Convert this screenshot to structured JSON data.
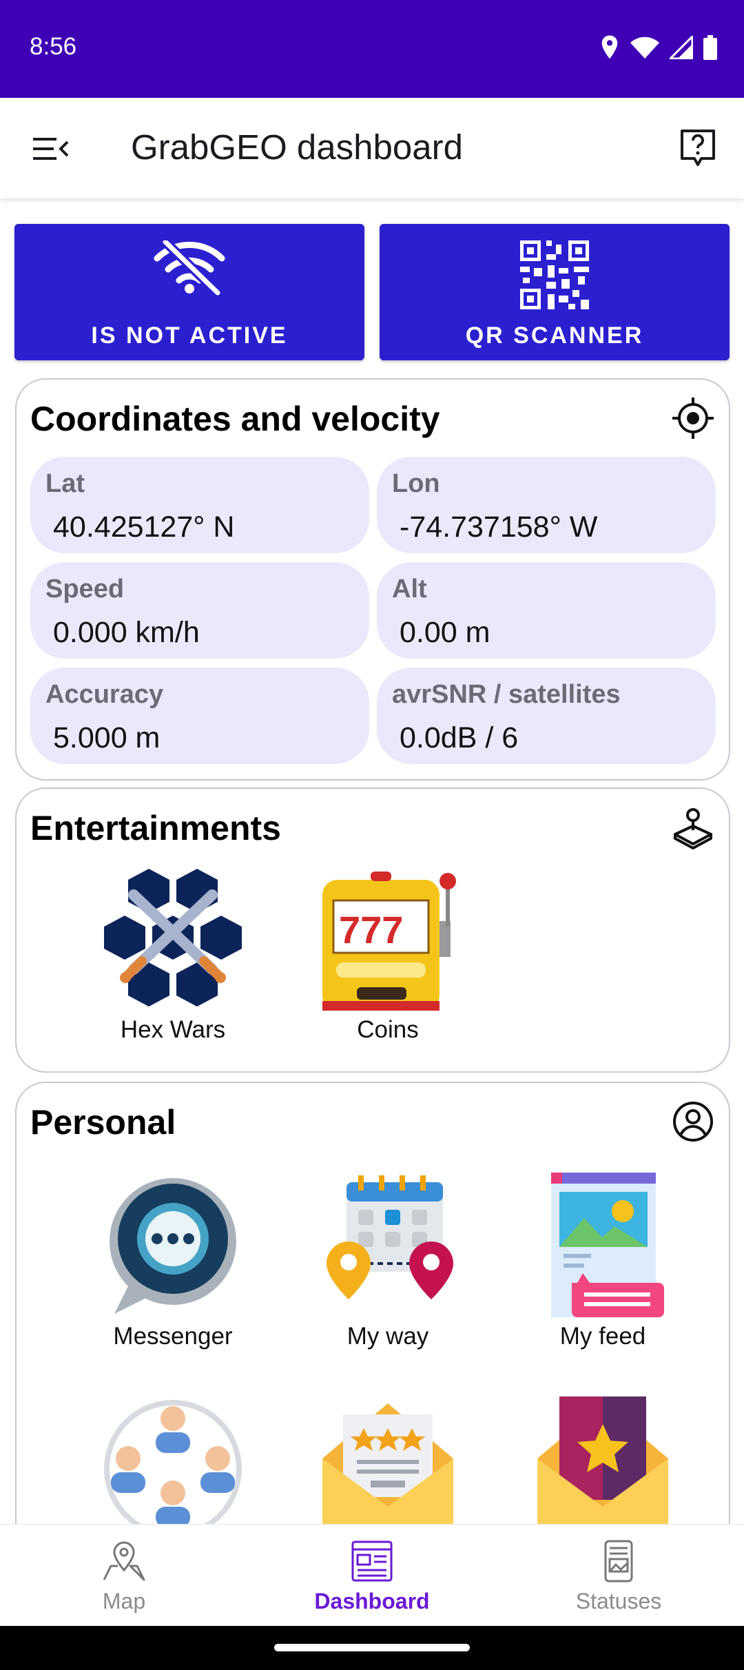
{
  "status": {
    "time": "8:56"
  },
  "appbar": {
    "title": "GrabGEO dashboard"
  },
  "buttons": {
    "wifi_label": "IS NOT ACTIVE",
    "qr_label": "QR SCANNER"
  },
  "coords": {
    "title": "Coordinates and velocity",
    "fields": [
      {
        "label": "Lat",
        "value": "40.425127° N"
      },
      {
        "label": "Lon",
        "value": "-74.737158° W"
      },
      {
        "label": "Speed",
        "value": "0.000 km/h"
      },
      {
        "label": "Alt",
        "value": "0.00 m"
      },
      {
        "label": "Accuracy",
        "value": "5.000 m"
      },
      {
        "label": "avrSNR / satellites",
        "value": "0.0dB / 6"
      }
    ]
  },
  "entertainments": {
    "title": "Entertainments",
    "items": [
      {
        "label": "Hex Wars"
      },
      {
        "label": "Coins"
      }
    ]
  },
  "personal": {
    "title": "Personal",
    "items": [
      {
        "label": "Messenger"
      },
      {
        "label": "My way"
      },
      {
        "label": "My feed"
      }
    ]
  },
  "nav": {
    "items": [
      {
        "label": "Map"
      },
      {
        "label": "Dashboard"
      },
      {
        "label": "Statuses"
      }
    ],
    "active": "Dashboard"
  },
  "colors": {
    "status_bar": "#3f00b5",
    "button": "#2c1fd0",
    "pill": "#e9e9fb",
    "nav_active": "#6a19d6"
  }
}
